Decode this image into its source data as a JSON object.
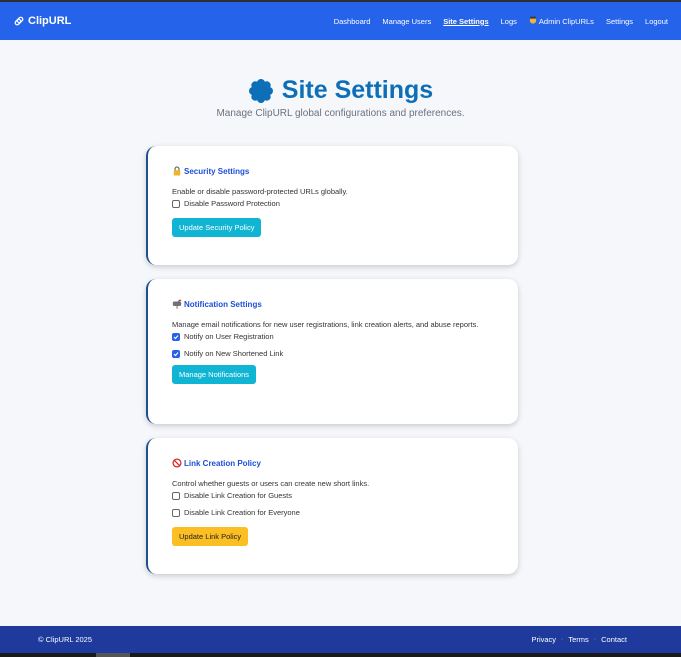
{
  "brand": {
    "name": "ClipURL",
    "icon": "paperclip-icon"
  },
  "nav": {
    "items": [
      {
        "label": "Dashboard",
        "active": false
      },
      {
        "label": "Manage Users",
        "active": false
      },
      {
        "label": "Site Settings",
        "active": true
      },
      {
        "label": "Logs",
        "active": false
      },
      {
        "label": "Admin ClipURLs",
        "active": false,
        "icon": "admin-emoji-icon"
      },
      {
        "label": "Settings",
        "active": false
      },
      {
        "label": "Logout",
        "active": false
      }
    ]
  },
  "header": {
    "title": "Site Settings",
    "title_icon": "gear-icon",
    "subtitle": "Manage ClipURL global configurations and preferences."
  },
  "security": {
    "title": "Security Settings",
    "icon": "lock-icon",
    "description": "Enable or disable password-protected URLs globally.",
    "options": [
      {
        "label": "Disable Password Protection",
        "checked": false
      }
    ],
    "button": "Update Security Policy"
  },
  "notifications": {
    "title": "Notification Settings",
    "icon": "mailbox-icon",
    "description": "Manage email notifications for new user registrations, link creation alerts, and abuse reports.",
    "options": [
      {
        "label": "Notify on User Registration",
        "checked": true
      },
      {
        "label": "Notify on New Shortened Link",
        "checked": true
      }
    ],
    "button": "Manage Notifications"
  },
  "link_policy": {
    "title": "Link Creation Policy",
    "icon": "prohibited-icon",
    "description": "Control whether guests or users can create new short links.",
    "options": [
      {
        "label": "Disable Link Creation for Guests",
        "checked": false
      },
      {
        "label": "Disable Link Creation for Everyone",
        "checked": false
      }
    ],
    "button": "Update Link Policy"
  },
  "footer": {
    "copyright": "© ClipURL 2025",
    "links": [
      "Privacy",
      "Terms",
      "Contact"
    ],
    "separator": "·"
  },
  "colors": {
    "navbar": "#2563eb",
    "footer": "#1e3a9c",
    "title": "#0d6fb8",
    "card_title": "#1d4ed8",
    "button_primary": "#11b5d4",
    "button_warning": "#fbbf24",
    "checkbox_checked": "#2563eb"
  }
}
